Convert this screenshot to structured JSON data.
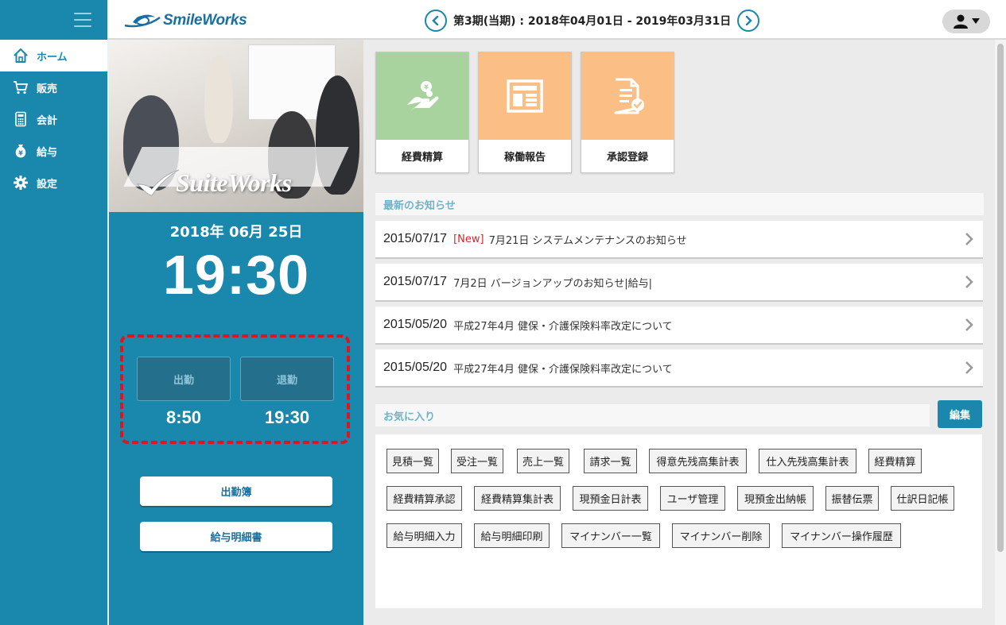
{
  "header": {
    "logo_text": "SmileWorks",
    "period_label": "第3期(当期) : 2018年04月01日 - 2019年03月31日"
  },
  "sidebar": {
    "items": [
      {
        "label": "ホーム",
        "icon": "home-icon"
      },
      {
        "label": "販売",
        "icon": "cart-icon"
      },
      {
        "label": "会計",
        "icon": "calculator-icon"
      },
      {
        "label": "給与",
        "icon": "money-bag-icon"
      },
      {
        "label": "設定",
        "icon": "gear-icon"
      }
    ]
  },
  "center": {
    "brand_text": "SuiteWorks",
    "date": "2018年 06月 25日",
    "time": "19:30",
    "clock_in_label": "出勤",
    "clock_out_label": "退勤",
    "clock_in_time": "8:50",
    "clock_out_time": "19:30",
    "attendance_button": "出勤簿",
    "payslip_button": "給与明細書"
  },
  "tiles": [
    {
      "label": "経費精算",
      "icon": "hand-coin-icon"
    },
    {
      "label": "稼働報告",
      "icon": "report-icon"
    },
    {
      "label": "承認登録",
      "icon": "document-check-icon"
    }
  ],
  "news": {
    "heading": "最新のお知らせ",
    "items": [
      {
        "date": "2015/07/17",
        "badge": "[New]",
        "text": "7月21日 システムメンテナンスのお知らせ"
      },
      {
        "date": "2015/07/17",
        "badge": "",
        "text": "7月2日 バージョンアップのお知らせ|給与|"
      },
      {
        "date": "2015/05/20",
        "badge": "",
        "text": "平成27年4月 健保・介護保険料率改定について"
      },
      {
        "date": "2015/05/20",
        "badge": "",
        "text": "平成27年4月 健保・介護保険料率改定について"
      }
    ]
  },
  "favorites": {
    "heading": "お気に入り",
    "edit_button": "編集",
    "items": [
      "見積一覧",
      "受注一覧",
      "売上一覧",
      "請求一覧",
      "得意先残高集計表",
      "仕入先残高集計表",
      "経費精算",
      "経費精算承認",
      "経費精算集計表",
      "現預金日計表",
      "ユーザ管理",
      "現預金出納帳",
      "振替伝票",
      "仕訳日記帳",
      "給与明細入力",
      "給与明細印刷",
      "マイナンバー一覧",
      "マイナンバー削除",
      "マイナンバー操作履歴"
    ]
  },
  "colors": {
    "primary": "#1a88ac",
    "tile_green": "#a9d39e",
    "tile_orange": "#fbbe84",
    "highlight_dashed": "#e0141e",
    "new_badge": "#d6252e"
  }
}
